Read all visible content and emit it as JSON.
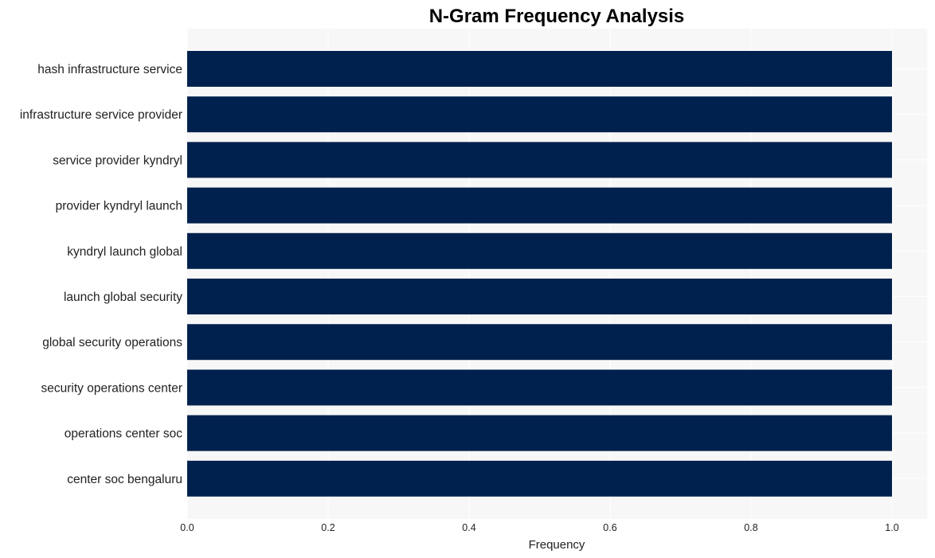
{
  "chart_data": {
    "type": "bar",
    "orientation": "horizontal",
    "title": "N-Gram Frequency Analysis",
    "xlabel": "Frequency",
    "ylabel": "",
    "categories": [
      "hash infrastructure service",
      "infrastructure service provider",
      "service provider kyndryl",
      "provider kyndryl launch",
      "kyndryl launch global",
      "launch global security",
      "global security operations",
      "security operations center",
      "operations center soc",
      "center soc bengaluru"
    ],
    "values": [
      1,
      1,
      1,
      1,
      1,
      1,
      1,
      1,
      1,
      1
    ],
    "xlim": [
      0,
      1.05
    ],
    "xticks": [
      0.0,
      0.2,
      0.4,
      0.6,
      0.8,
      1.0
    ],
    "xtick_labels": [
      "0.0",
      "0.2",
      "0.4",
      "0.6",
      "0.8",
      "1.0"
    ],
    "grid": true,
    "legend": "none",
    "colors": {
      "bar": "#00214d",
      "plot_background": "#f7f7f7",
      "grid": "#ffffff"
    }
  }
}
